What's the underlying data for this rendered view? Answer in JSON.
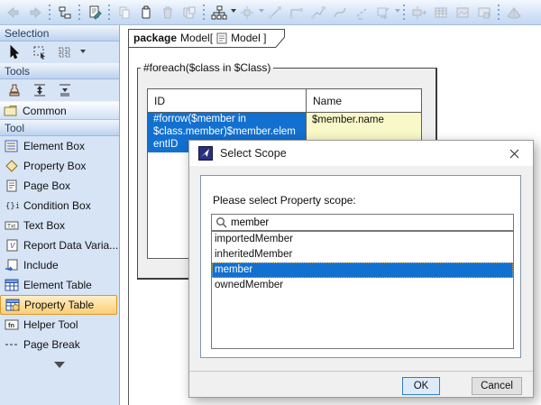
{
  "toolbar": {
    "icons": [
      "back",
      "forward",
      "containment-tree",
      "edit-report-template",
      "copy",
      "paste",
      "delete",
      "paste-duplicate",
      "tree-layout",
      "center-layout",
      "draw-line",
      "draw-rectilinear",
      "draw-oblique",
      "draw-curve",
      "draw-dashed",
      "reset-edge",
      "fit-size",
      "insert-table",
      "insert-image",
      "preview-screen",
      "perspective"
    ]
  },
  "sidebar": {
    "sections": {
      "selection": "Selection",
      "tools": "Tools",
      "common": "Common",
      "tool": "Tool"
    },
    "tool_items": [
      {
        "label": "Element Box",
        "selected": false
      },
      {
        "label": "Property Box",
        "selected": false
      },
      {
        "label": "Page Box",
        "selected": false
      },
      {
        "label": "Condition Box",
        "selected": false
      },
      {
        "label": "Text Box",
        "selected": false
      },
      {
        "label": "Report Data Varia...",
        "selected": false
      },
      {
        "label": "Include",
        "selected": false
      },
      {
        "label": "Element Table",
        "selected": false
      },
      {
        "label": "Property Table",
        "selected": true
      },
      {
        "label": "Helper Tool",
        "selected": false
      },
      {
        "label": "Page Break",
        "selected": false
      }
    ]
  },
  "canvas": {
    "tab": {
      "keyword": "package",
      "text_before_icon": "Model[",
      "text_after_icon": "Model ]"
    },
    "foreach_label": "#foreach($class in $Class)",
    "table": {
      "headers": [
        "ID",
        "Name"
      ],
      "row": {
        "id": "#forrow($member in $class.member)$member.elementID",
        "name": "$member.name"
      }
    }
  },
  "dialog": {
    "title": "Select Scope",
    "prompt": "Please select Property scope:",
    "search_value": "member",
    "options": [
      "importedMember",
      "inheritedMember",
      "member",
      "ownedMember"
    ],
    "selected_option": "member",
    "buttons": {
      "ok": "OK",
      "cancel": "Cancel"
    }
  },
  "colors": {
    "selection_blue": "#1270d0",
    "cell_yellow": "#f8f8c8",
    "tool_highlight_fill": "#fbce77",
    "tool_highlight_border": "#d99a2c",
    "sidebar_bg": "#d6e4f6",
    "toolbar_bg": "#d2e2f6",
    "frame_fill": "#efefef",
    "dialog_bg": "#f0f0f0",
    "ok_button_fill": "#ddeafa",
    "ok_button_border": "#2d7fc4"
  }
}
